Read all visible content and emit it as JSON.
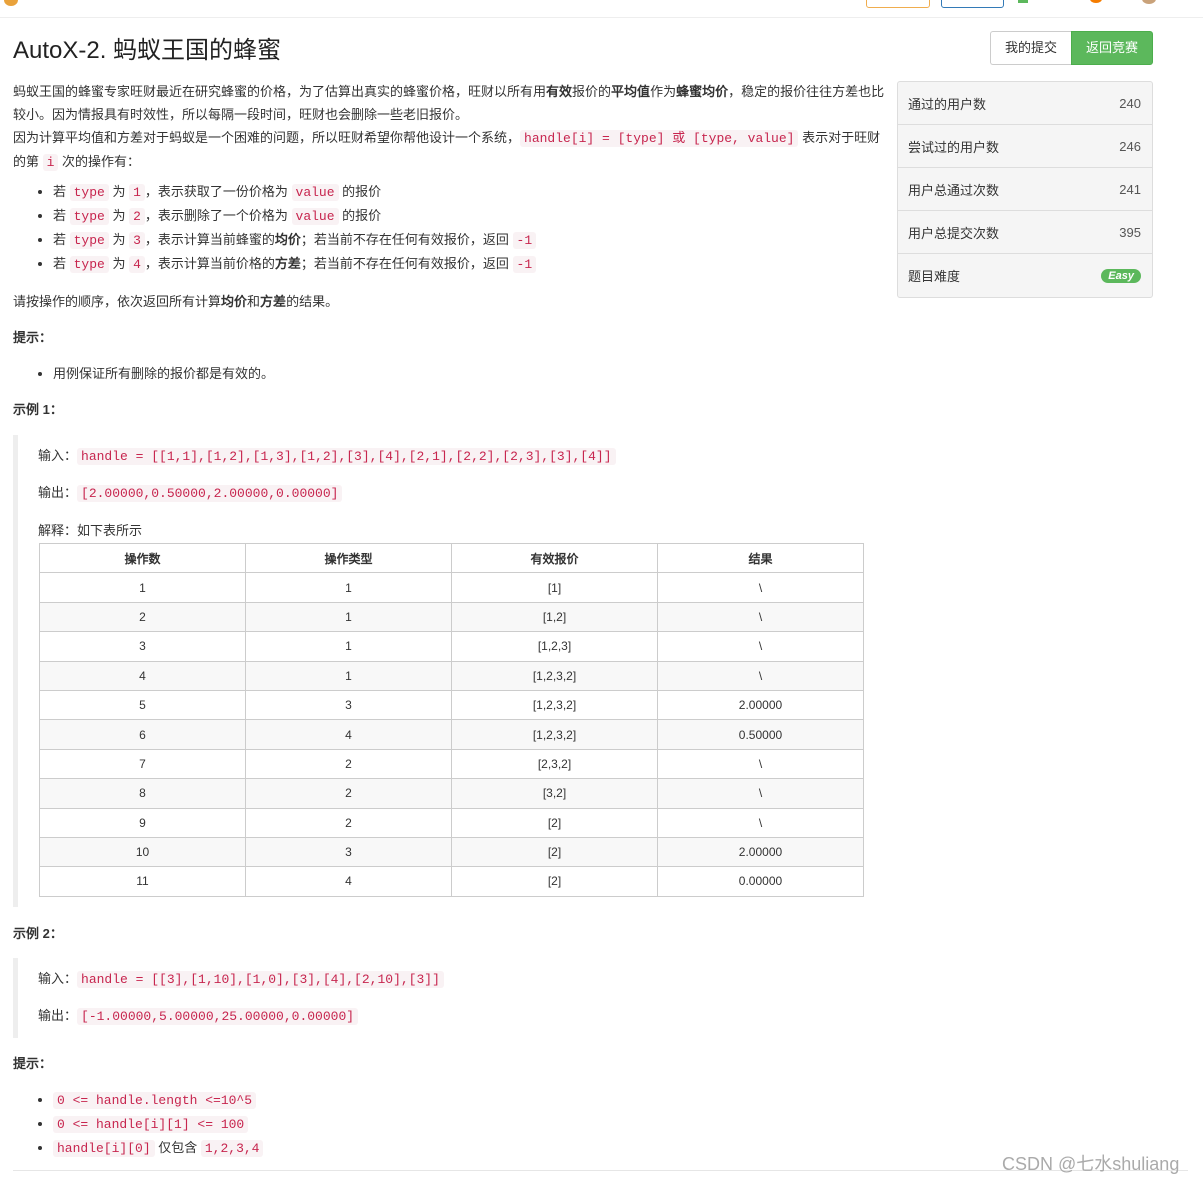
{
  "header": {
    "title": "AutoX-2. 蚂蚁王国的蜂蜜",
    "my_submissions": "我的提交",
    "back_to_contest": "返回竞赛"
  },
  "stats": [
    {
      "label": "通过的用户数",
      "value": "240"
    },
    {
      "label": "尝试过的用户数",
      "value": "246"
    },
    {
      "label": "用户总通过次数",
      "value": "241"
    },
    {
      "label": "用户总提交次数",
      "value": "395"
    }
  ],
  "difficulty": {
    "label": "题目难度",
    "value": "Easy"
  },
  "desc": {
    "p1a": "蚂蚁王国的蜂蜜专家旺财最近在研究蜂蜜的价格，为了估算出真实的蜂蜜价格，旺财以所有用",
    "p1b1": "有效",
    "p1c": "报价的",
    "p1b2": "平均值",
    "p1d": "作为",
    "p1b3": "蜂蜜均价",
    "p1e": "，稳定的报价往往方差也比较小。因为情报具有时效性，所以每隔一段时间，旺财也会删除一些老旧报价。",
    "p2a": "因为计算平均值和方差对于蚂蚁是一个困难的问题，所以旺财希望你帮他设计一个系统，",
    "p2code": "handle[i] = [type] 或 [type, value]",
    "p2b": " 表示对于旺财的第 ",
    "p2i": "i",
    "p2c": " 次的操作有：",
    "ops": [
      {
        "a": "若 ",
        "t": "type",
        "b": " 为 ",
        "n": "1",
        "c": "，表示获取了一份价格为 ",
        "v": "value",
        "d": " 的报价",
        "e": ""
      },
      {
        "a": "若 ",
        "t": "type",
        "b": " 为 ",
        "n": "2",
        "c": "，表示删除了一个价格为 ",
        "v": "value",
        "d": " 的报价",
        "e": ""
      },
      {
        "a": "若 ",
        "t": "type",
        "b": " 为 ",
        "n": "3",
        "c": "，表示计算当前蜂蜜的",
        "bold": "均价",
        "d2": "；若当前不存在任何有效报价，返回 ",
        "r": "-1"
      },
      {
        "a": "若 ",
        "t": "type",
        "b": " 为 ",
        "n": "4",
        "c": "，表示计算当前价格的",
        "bold": "方差",
        "d2": "；若当前不存在任何有效报价，返回 ",
        "r": "-1"
      }
    ],
    "p3a": "请按操作的顺序，依次返回所有计算",
    "p3b1": "均价",
    "p3c": "和",
    "p3b2": "方差",
    "p3d": "的结果。",
    "hint_title": "提示：",
    "hint": "用例保证所有删除的报价都是有效的。"
  },
  "example1": {
    "title": "示例 1：",
    "input_label": "输入：",
    "input": "handle = [[1,1],[1,2],[1,3],[1,2],[3],[4],[2,1],[2,2],[2,3],[3],[4]]",
    "output_label": "输出：",
    "output": "[2.00000,0.50000,2.00000,0.00000]",
    "explain": "解释：如下表所示",
    "table": {
      "headers": [
        "操作数",
        "操作类型",
        "有效报价",
        "结果"
      ],
      "rows": [
        [
          "1",
          "1",
          "[1]",
          "\\"
        ],
        [
          "2",
          "1",
          "[1,2]",
          "\\"
        ],
        [
          "3",
          "1",
          "[1,2,3]",
          "\\"
        ],
        [
          "4",
          "1",
          "[1,2,3,2]",
          "\\"
        ],
        [
          "5",
          "3",
          "[1,2,3,2]",
          "2.00000"
        ],
        [
          "6",
          "4",
          "[1,2,3,2]",
          "0.50000"
        ],
        [
          "7",
          "2",
          "[2,3,2]",
          "\\"
        ],
        [
          "8",
          "2",
          "[3,2]",
          "\\"
        ],
        [
          "9",
          "2",
          "[2]",
          "\\"
        ],
        [
          "10",
          "3",
          "[2]",
          "2.00000"
        ],
        [
          "11",
          "4",
          "[2]",
          "0.00000"
        ]
      ]
    }
  },
  "example2": {
    "title": "示例 2：",
    "input_label": "输入：",
    "input": "handle = [[3],[1,10],[1,0],[3],[4],[2,10],[3]]",
    "output_label": "输出：",
    "output": "[-1.00000,5.00000,25.00000,0.00000]"
  },
  "constraints": {
    "title": "提示：",
    "c1": "0 <= handle.length <=10^5",
    "c2": "0 <= handle[i][1] <= 100",
    "c3a": "handle[i][0]",
    "c3b": " 仅包含 ",
    "c3c": "1,2,3,4"
  },
  "watermark": "CSDN @七水shuliang"
}
